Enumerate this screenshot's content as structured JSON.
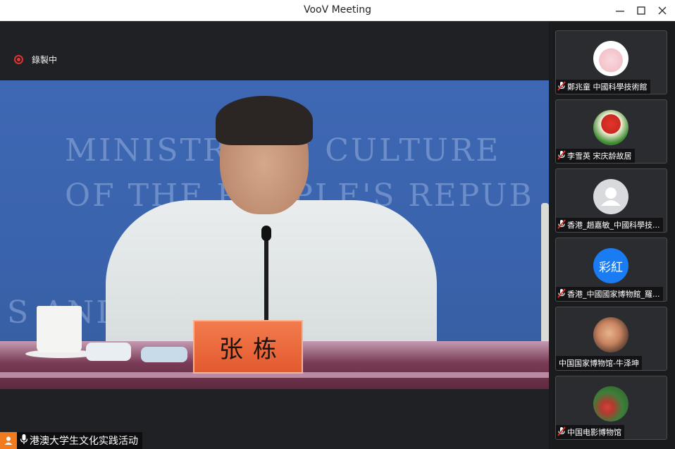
{
  "window": {
    "title": "VooV Meeting"
  },
  "recording": {
    "label": "錄製中"
  },
  "main_video": {
    "wall_lines": [
      "MINISTRY OF CULTURE",
      "OF THE PEOPLE'S REPUB",
      "S AND       MINISTRY"
    ],
    "nameplate": "张栋"
  },
  "stage_caption": {
    "name": "港澳大学生文化实践活动"
  },
  "participants": [
    {
      "name": "鄭兆童 中國科學技術館",
      "avatar": "pink-avatar-icon",
      "muted": true
    },
    {
      "name": "李雪英 宋庆龄故居",
      "avatar": "tulip-avatar-icon",
      "muted": true
    },
    {
      "name": "香港_趙嘉敏_中國科學技...",
      "avatar": "default-user-icon",
      "muted": true
    },
    {
      "name": "香港_中國國家博物館_羅...",
      "avatar_text": "彩紅",
      "muted": true
    },
    {
      "name": "中国国家博物馆-牛泽坤",
      "avatar": "photo-avatar-icon",
      "muted": false
    },
    {
      "name": "中国电影博物馆",
      "avatar": "flower-avatar-icon",
      "muted": true
    }
  ],
  "colors": {
    "recording": "#e33333",
    "mute": "#e5332a",
    "avatar_blue": "#1a7cf2",
    "caption_avatar": "#f07c1e"
  }
}
